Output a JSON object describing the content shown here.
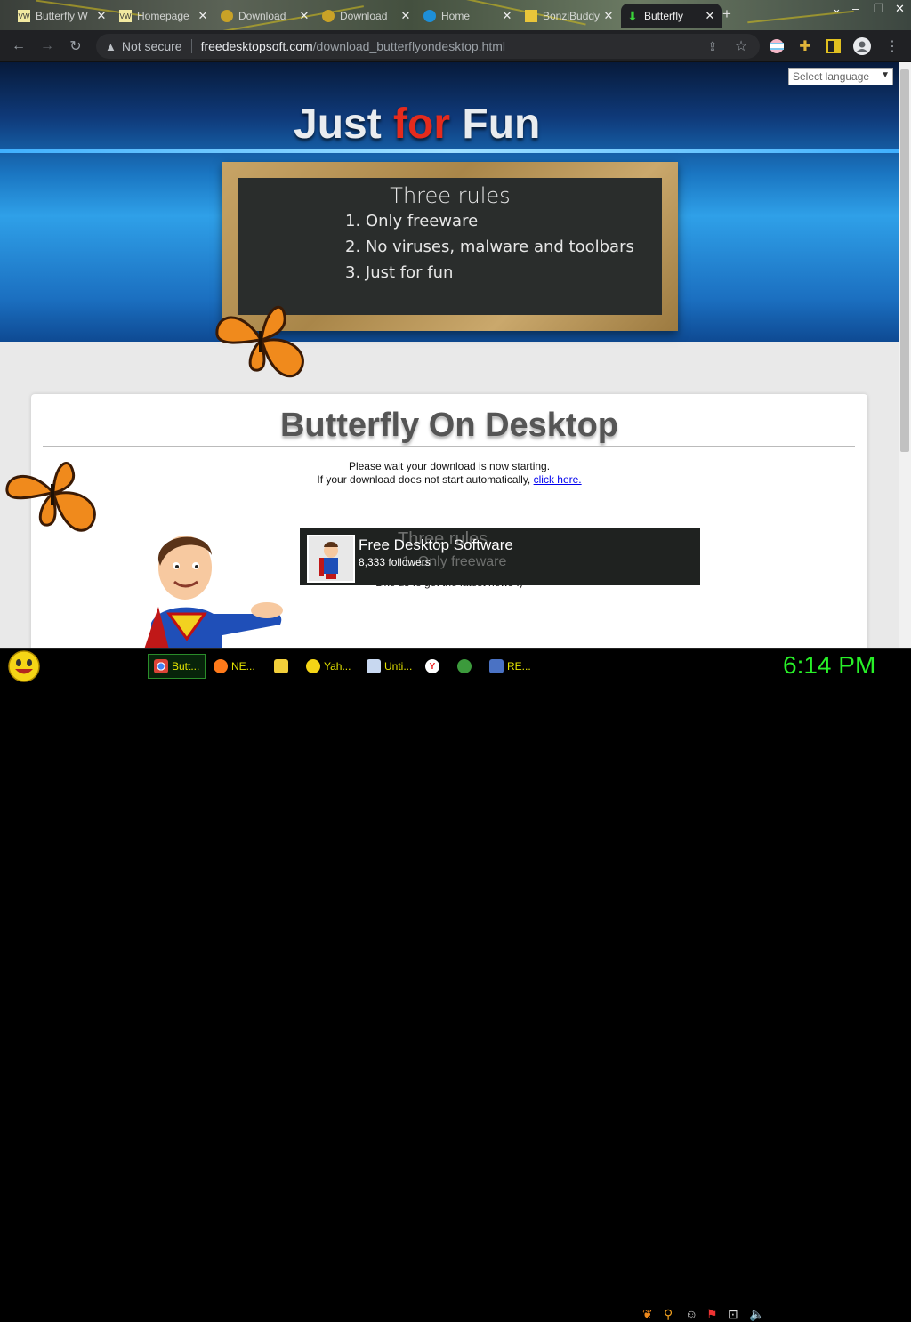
{
  "browser": {
    "tabs": [
      {
        "title": "Butterfly W",
        "icon": "webpage-icon"
      },
      {
        "title": "Homepage",
        "icon": "webpage-icon"
      },
      {
        "title": "Download",
        "icon": "globe-icon"
      },
      {
        "title": "Download",
        "icon": "globe-icon"
      },
      {
        "title": "Home",
        "icon": "edge-icon"
      },
      {
        "title": "BonziBuddy",
        "icon": "folder-icon"
      },
      {
        "title": "Butterfly",
        "icon": "download-icon"
      }
    ],
    "security_label": "Not secure",
    "url_domain": "freedesktopsoft.com",
    "url_path": "/download_butterflyondesktop.html"
  },
  "page": {
    "language_select": "Select language",
    "logo_just": "Just",
    "logo_for": "for",
    "logo_fun": "Fun",
    "board_title": "Three rules",
    "rules": [
      "1. Only freeware",
      "2. No viruses, malware and toolbars",
      "3. Just for fun"
    ],
    "heading": "Butterfly On Desktop",
    "wait_line1": "Please wait your download is now starting.",
    "wait_line2": "If your download does not start automatically,",
    "click_here": "click here.",
    "like_us": "Like us to get the latest news :)",
    "fb_name": "Free Desktop Software",
    "fb_followers": "8,333 followers",
    "fb_ghost_title": "Three rules",
    "fb_ghost_rule": "1. Only freeware"
  },
  "taskbar": {
    "items": [
      {
        "label": "Butt...",
        "icon": "chrome-icon"
      },
      {
        "label": "NE...",
        "icon": "firefox-icon"
      },
      {
        "label": "",
        "icon": "folder-icon"
      },
      {
        "label": "Yah...",
        "icon": "yahoo-messenger-icon"
      },
      {
        "label": "Unti...",
        "icon": "notepad-icon"
      },
      {
        "label": "",
        "icon": "yandex-icon"
      },
      {
        "label": "",
        "icon": "refresh-app-icon"
      },
      {
        "label": "RE...",
        "icon": "regedit-icon"
      }
    ],
    "clock": "6:14 PM"
  },
  "colors": {
    "accent_red": "#e52b1d",
    "clock_green": "#28f028",
    "taskbar_text": "#e4e400"
  }
}
